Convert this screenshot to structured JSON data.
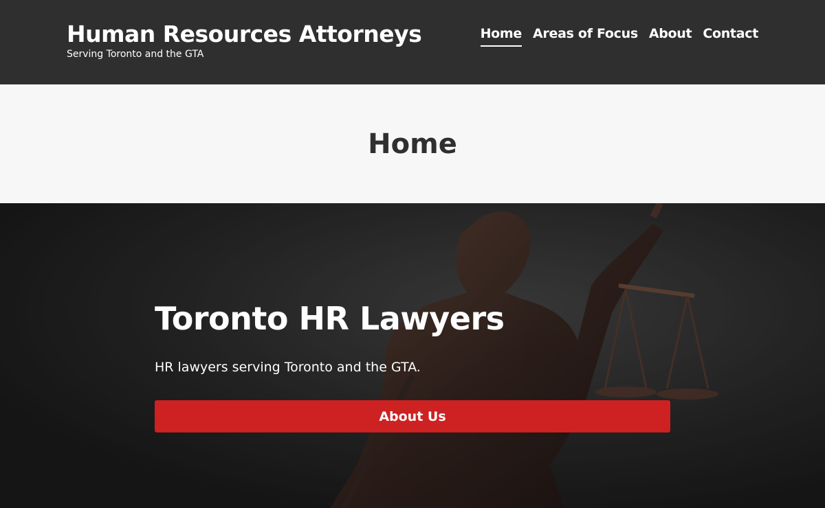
{
  "header": {
    "site_title": "Human Resources Attorneys",
    "tagline": "Serving Toronto and the GTA",
    "nav": [
      {
        "label": "Home",
        "active": true
      },
      {
        "label": "Areas of Focus",
        "active": false
      },
      {
        "label": "About",
        "active": false
      },
      {
        "label": "Contact",
        "active": false
      }
    ]
  },
  "page_title": "Home",
  "hero": {
    "heading": "Toronto HR Lawyers",
    "text": "HR lawyers serving Toronto and the GTA.",
    "button_label": "About Us",
    "background_image": "lady-justice-statue"
  },
  "colors": {
    "header_bg": "#2f2f2f",
    "title_band_bg": "#f7f7f7",
    "button_bg": "#cd2122",
    "hero_bg": "#262626"
  }
}
